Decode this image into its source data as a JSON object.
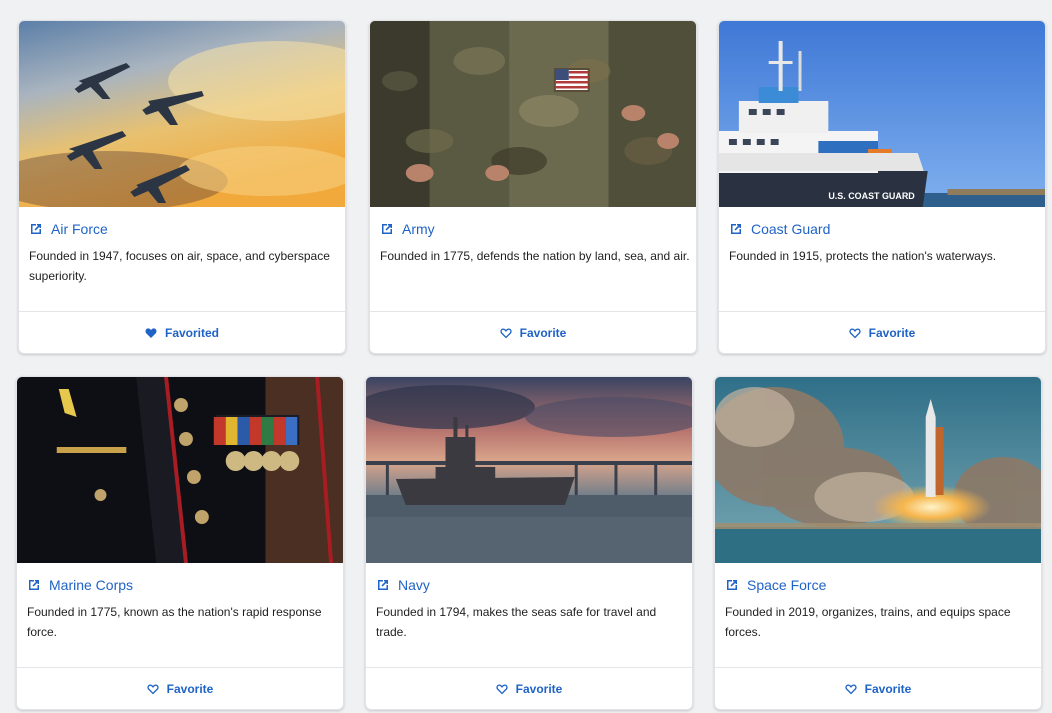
{
  "cards": [
    {
      "title": "Air Force",
      "description": "Founded in 1947, focuses on air, space, and cyberspace superiority.",
      "favorite_label": "Favorited",
      "favorited": true,
      "image": "fighter-jets-sunset"
    },
    {
      "title": "Army",
      "description": "Founded in 1775, defends the nation by land, sea, and air.",
      "favorite_label": "Favorite",
      "favorited": false,
      "image": "soldiers-camouflage-flag-patch"
    },
    {
      "title": "Coast Guard",
      "description": "Founded in 1915, protects the nation's waterways.",
      "favorite_label": "Favorite",
      "favorited": false,
      "image": "coast-guard-ship",
      "image_text": "U.S. COAST GUARD"
    },
    {
      "title": "Marine Corps",
      "description": "Founded in 1775, known as the nation's rapid response force.",
      "favorite_label": "Favorite",
      "favorited": false,
      "image": "marine-dress-uniform-medals"
    },
    {
      "title": "Navy",
      "description": "Founded in 1794, makes the seas safe for travel and trade.",
      "favorite_label": "Favorite",
      "favorited": false,
      "image": "navy-ship-bridge"
    },
    {
      "title": "Space Force",
      "description": "Founded in 2019, organizes, trains, and equips space forces.",
      "favorite_label": "Favorite",
      "favorited": false,
      "image": "rocket-launch"
    }
  ],
  "colors": {
    "accent": "#1f63c6",
    "background": "#f0f1f3",
    "card": "#ffffff"
  }
}
